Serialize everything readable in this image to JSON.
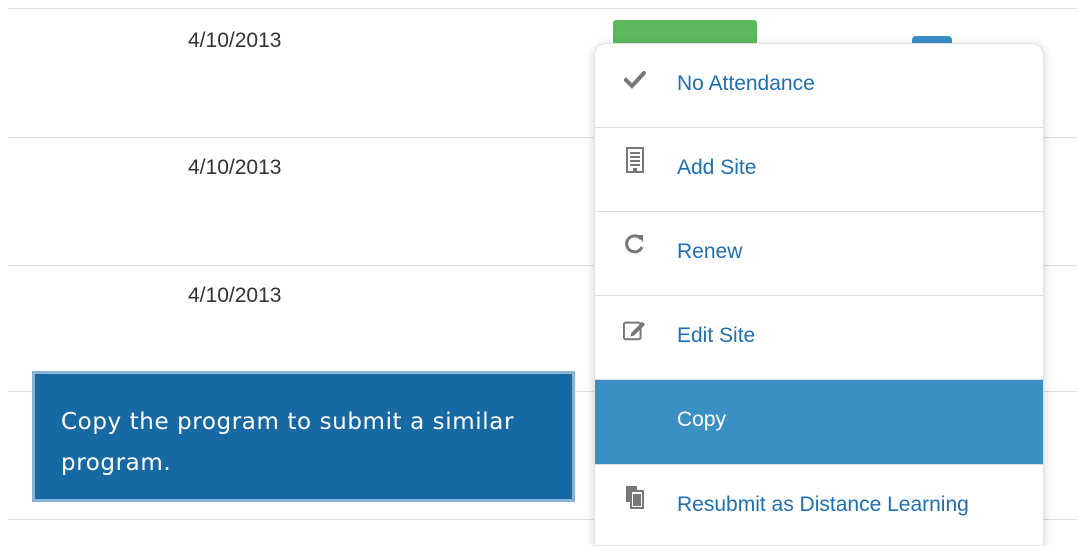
{
  "table": {
    "rows": [
      {
        "date": "4/10/2013"
      },
      {
        "date": "4/10/2013"
      },
      {
        "date": "4/10/2013"
      }
    ]
  },
  "tooltip": {
    "text": "Copy the program to submit a similar program."
  },
  "menu": {
    "items": [
      {
        "label": "No Attendance",
        "icon": "check-icon"
      },
      {
        "label": "Add Site",
        "icon": "building-icon"
      },
      {
        "label": "Renew",
        "icon": "refresh-icon"
      },
      {
        "label": "Edit Site",
        "icon": "edit-icon"
      },
      {
        "label": "Copy",
        "icon": "copy-icon",
        "active": true
      },
      {
        "label": "Resubmit as Distance Learning",
        "icon": "documents-icon"
      }
    ]
  },
  "colors": {
    "menu_link": "#1f6fb2",
    "menu_active_bg": "#3a8fc4",
    "tooltip_bg": "#1769a4",
    "status_green": "#5cb85c"
  }
}
